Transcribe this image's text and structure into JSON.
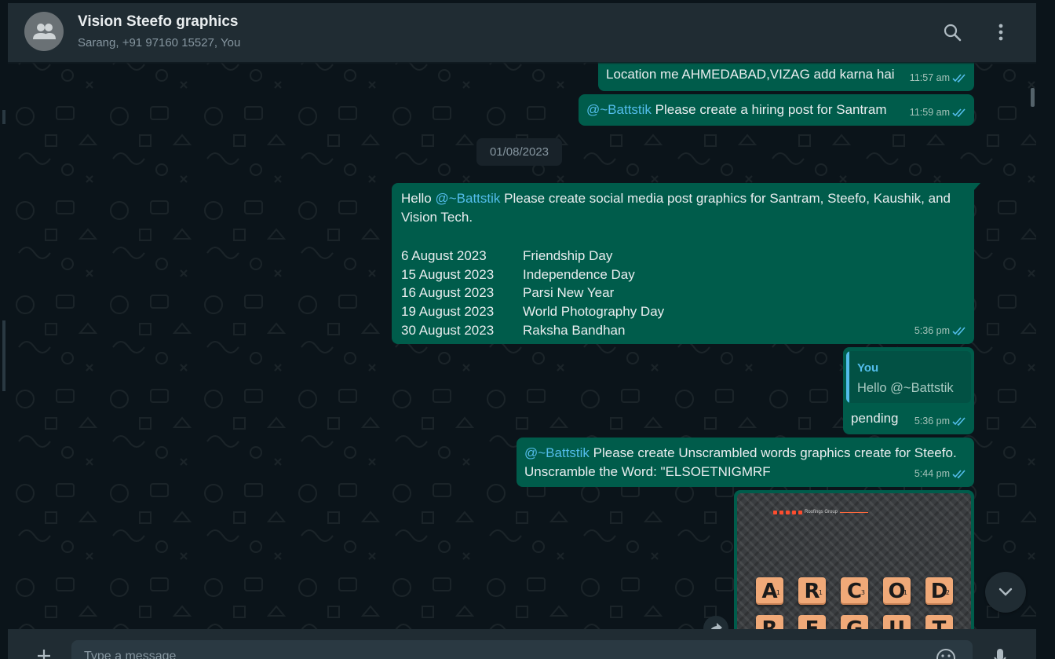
{
  "header": {
    "title": "Vision Steefo graphics",
    "subtitle": "Sarang, +91 97160 15527, You"
  },
  "messages": [
    {
      "text": "Location me AHMEDABAD,VIZAG add karna hai",
      "time": "11:57 am"
    },
    {
      "mention": "@~Battstik",
      "text": " Please create a hiring post for Santram",
      "time": "11:59 am"
    }
  ],
  "date_separator": "01/08/2023",
  "event_message": {
    "greeting": "Hello ",
    "mention": "@~Battstik",
    "text": " Please create social media post graphics for Santram, Steefo, Kaushik, and Vision Tech.",
    "events": [
      {
        "date": "6 August 2023",
        "name": "Friendship Day"
      },
      {
        "date": "15 August 2023",
        "name": "Independence Day"
      },
      {
        "date": "16 August 2023",
        "name": "Parsi New Year"
      },
      {
        "date": "19 August 2023",
        "name": "World Photography Day"
      },
      {
        "date": "30 August 2023",
        "name": "Raksha Bandhan"
      }
    ],
    "time": "5:36 pm"
  },
  "reply_message": {
    "quoted_author": "You",
    "quoted_text": "Hello @~Battstik",
    "text": "pending",
    "time": "5:36 pm"
  },
  "unscramble_message": {
    "mention": "@~Battstik",
    "text": " Please create Unscrambled words graphics create for Steefo. Unscramble the Word: \"ELSOETNIGMRF",
    "time": "5:44 pm"
  },
  "image_message": {
    "brand_text": "Roofings Group",
    "tiles_row1": [
      {
        "letter": "A",
        "score": "1"
      },
      {
        "letter": "R",
        "score": "1"
      },
      {
        "letter": "C",
        "score": "3"
      },
      {
        "letter": "O",
        "score": "1"
      },
      {
        "letter": "D",
        "score": "2"
      }
    ],
    "tiles_row2": [
      {
        "letter": "R",
        "score": ""
      },
      {
        "letter": "F",
        "score": ""
      },
      {
        "letter": "G",
        "score": ""
      },
      {
        "letter": "U",
        "score": ""
      },
      {
        "letter": "T",
        "score": ""
      }
    ]
  },
  "footer": {
    "input_placeholder": "Type a message"
  },
  "icons": {
    "avatar": "group-icon",
    "search": "search-icon",
    "menu": "kebab-menu-icon",
    "read_receipt": "double-check-icon",
    "forward": "forward-icon",
    "scroll_down": "chevron-down-icon",
    "attach": "plus-icon",
    "emoji": "emoji-icon",
    "mic": "mic-icon"
  },
  "colors": {
    "outgoing_bubble": "#005c4b",
    "mention": "#53bdeb",
    "header_bg": "#202c33",
    "chat_bg": "#0b141a",
    "read_receipt": "#53bdeb"
  }
}
